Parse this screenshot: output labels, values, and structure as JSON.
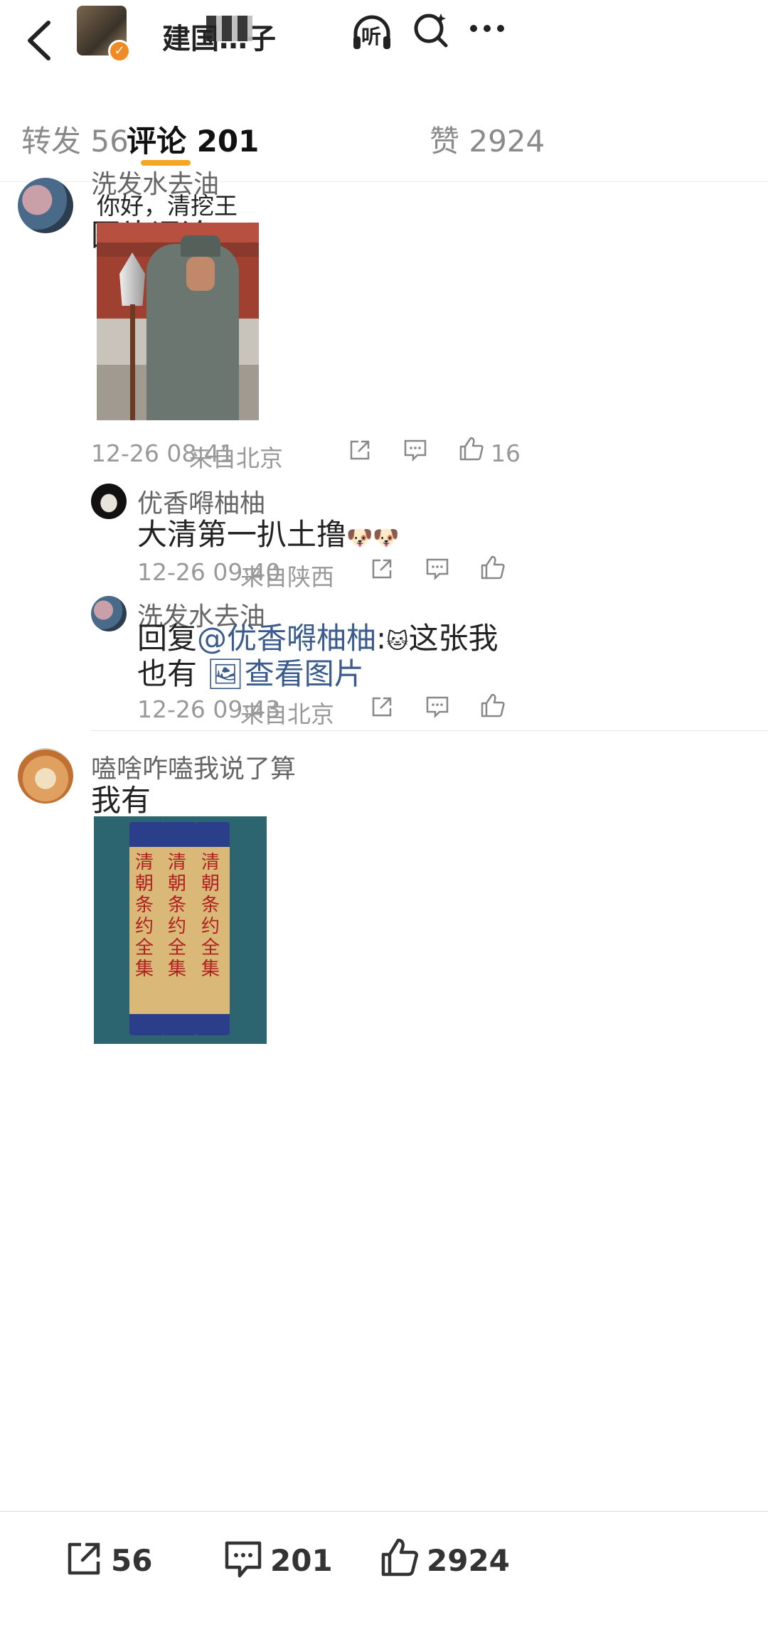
{
  "header": {
    "title": "建国…子",
    "listen_label": "听"
  },
  "tabs": {
    "forward": "转发 56",
    "comments": "评论 201",
    "likes": "赞 2924"
  },
  "comments": [
    {
      "user": "洗发水去油",
      "text": "图片评论",
      "image_caption": "你好，清挖王子",
      "time": "12-26 08:41",
      "location": "来自北京",
      "likes": "16",
      "replies": [
        {
          "user": "优香嘚柚柚",
          "text": "大清第一扒土撸",
          "emoji": "🐶🐶",
          "time": "12-26 09:40",
          "location": "来自陕西"
        },
        {
          "user": "洗发水去油",
          "reply_prefix": "回复",
          "mention": "@优香嘚柚柚",
          "colon": ":",
          "emoji": "🐱",
          "text": "这张我也有",
          "view_image": "查看图片",
          "time": "12-26 09:43",
          "location": "来自北京"
        }
      ]
    },
    {
      "user": "嗑啥咋嗑我说了算",
      "text": "我有",
      "book_title": "清朝条约全集"
    }
  ],
  "bottom_bar": {
    "forward_count": "56",
    "comment_count": "201",
    "like_count": "2924"
  },
  "colors": {
    "tab_indicator": "#f5a623",
    "link": "#3a5b8c",
    "verified_badge": "#f08a24"
  }
}
